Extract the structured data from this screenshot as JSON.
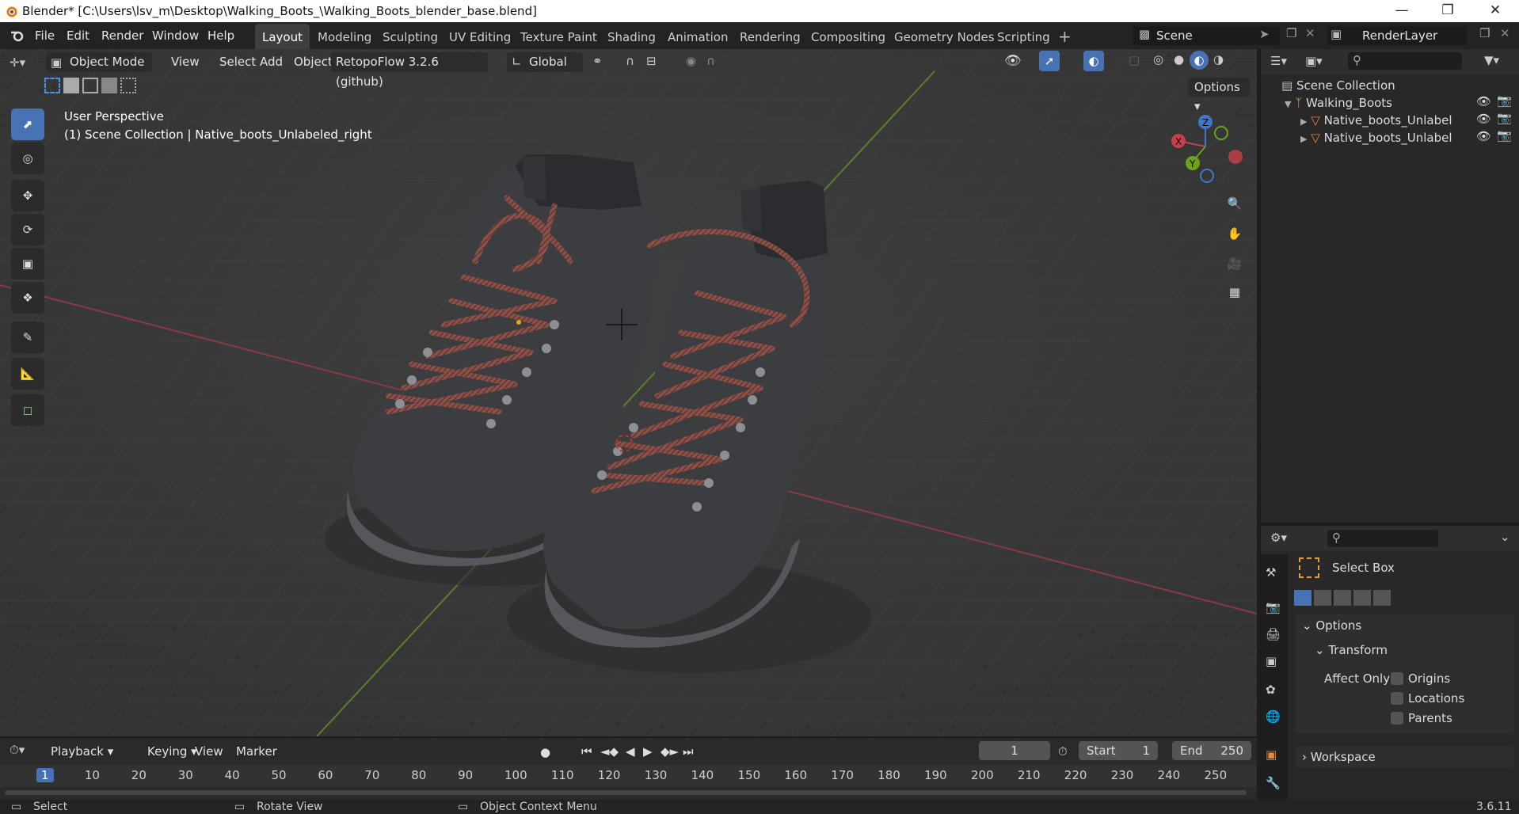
{
  "window": {
    "title": "Blender* [C:\\Users\\lsv_m\\Desktop\\Walking_Boots_\\Walking_Boots_blender_base.blend]"
  },
  "menus": [
    "File",
    "Edit",
    "Render",
    "Window",
    "Help"
  ],
  "workspaces": [
    "Layout",
    "Modeling",
    "Sculpting",
    "UV Editing",
    "Texture Paint",
    "Shading",
    "Animation",
    "Rendering",
    "Compositing",
    "Geometry Nodes",
    "Scripting"
  ],
  "scene_field": "Scene",
  "renderlayer_field": "RenderLayer",
  "viewport": {
    "mode": "Object Mode",
    "header_menus": [
      "View",
      "Select",
      "Add",
      "Object"
    ],
    "addon": "RetopoFlow 3.2.6 (github)",
    "orientation": "Global",
    "options_label": "Options",
    "overlay_line1": "User Perspective",
    "overlay_line2": "(1) Scene Collection | Native_boots_Unlabeled_right",
    "gizmo_axes": [
      "X",
      "Y",
      "Z"
    ]
  },
  "tools": [
    "select-box",
    "cursor",
    "move",
    "rotate",
    "scale",
    "transform",
    "annotate",
    "measure",
    "add-cube"
  ],
  "outliner": {
    "root": "Scene Collection",
    "items": [
      {
        "label": "Walking_Boots"
      },
      {
        "label": "Native_boots_Unlabel"
      },
      {
        "label": "Native_boots_Unlabel"
      }
    ]
  },
  "properties": {
    "tool_name": "Select Box",
    "section_options": "Options",
    "section_transform": "Transform",
    "affect_only": "Affect Only",
    "checks": [
      "Origins",
      "Locations",
      "Parents"
    ],
    "section_workspace": "Workspace"
  },
  "timeline": {
    "menus": [
      "Playback",
      "Keying",
      "View",
      "Marker"
    ],
    "current_frame": "1",
    "start_label": "Start",
    "start": "1",
    "end_label": "End",
    "end": "250",
    "ruler": [
      "1",
      "10",
      "20",
      "30",
      "40",
      "50",
      "60",
      "70",
      "80",
      "90",
      "100",
      "110",
      "120",
      "130",
      "140",
      "150",
      "160",
      "170",
      "180",
      "190",
      "200",
      "210",
      "220",
      "230",
      "240",
      "250"
    ]
  },
  "statusbar": {
    "select": "Select",
    "rotate": "Rotate View",
    "context": "Object Context Menu",
    "version": "3.6.11"
  },
  "colors": {
    "accent": "#4772b3",
    "x_axis": "#c8414a",
    "y_axis": "#6ca21b",
    "z_axis": "#3f76c8",
    "boot": "#3c3d41",
    "lace": "#8b5048"
  }
}
